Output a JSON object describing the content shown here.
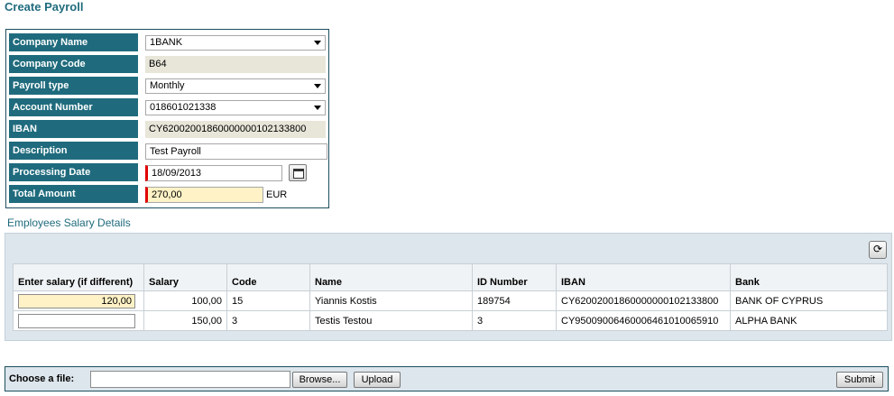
{
  "page": {
    "title": "Create Payroll"
  },
  "form": {
    "company_name": {
      "label": "Company Name",
      "value": "1BANK"
    },
    "company_code": {
      "label": "Company Code",
      "value": "B64"
    },
    "payroll_type": {
      "label": "Payroll type",
      "value": "Monthly"
    },
    "account_number": {
      "label": "Account Number",
      "value": "018601021338"
    },
    "iban": {
      "label": "IBAN",
      "value": "CY62002001860000000102133800"
    },
    "description": {
      "label": "Description",
      "value": "Test Payroll"
    },
    "processing_date": {
      "label": "Processing Date",
      "value": "18/09/2013"
    },
    "total_amount": {
      "label": "Total Amount",
      "value": "270,00",
      "currency": "EUR"
    }
  },
  "employees": {
    "section_title": "Employees Salary Details",
    "columns": {
      "enter_salary": "Enter salary (if different)",
      "salary": "Salary",
      "code": "Code",
      "name": "Name",
      "id_number": "ID Number",
      "iban": "IBAN",
      "bank": "Bank"
    },
    "rows": [
      {
        "enter_salary": "120,00",
        "salary": "100,00",
        "code": "15",
        "name": "Yiannis Kostis",
        "id_number": "189754",
        "iban": "CY62002001860000000102133800",
        "bank": "BANK OF CYPRUS"
      },
      {
        "enter_salary": "",
        "salary": "150,00",
        "code": "3",
        "name": "Testis Testou",
        "id_number": "3",
        "iban": "CY95009006460006461010065910",
        "bank": "ALPHA BANK"
      }
    ]
  },
  "upload": {
    "label": "Choose a file:",
    "browse": "Browse...",
    "upload": "Upload",
    "submit": "Submit"
  },
  "icons": {
    "dropdown": "chevron-down-icon",
    "calendar": "calendar-icon",
    "refresh": "refresh-icon"
  },
  "colors": {
    "label_bg": "#1f6b7d",
    "required": "#e00000",
    "highlight": "#fff2c6",
    "readonly": "#e8e6d9"
  }
}
